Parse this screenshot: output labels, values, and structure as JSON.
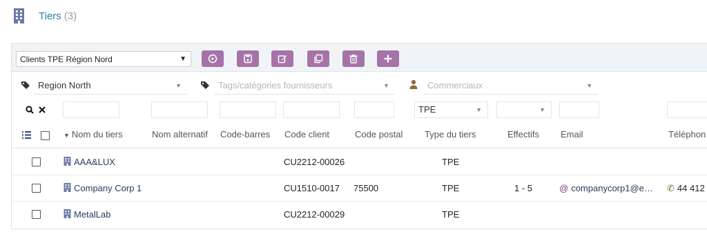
{
  "header": {
    "title": "Tiers",
    "count": "(3)"
  },
  "toolbar": {
    "view_select": "Clients TPE Région Nord",
    "buttons": [
      "play-icon",
      "save-icon",
      "edit-icon",
      "copy-icon",
      "trash-icon",
      "plus-icon"
    ]
  },
  "filters": {
    "region": "Region North",
    "tags_placeholder": "Tags/catégories fournisseurs",
    "sales_placeholder": "Commerciaux"
  },
  "search": {
    "type_value": "TPE"
  },
  "columns": [
    "Nom du tiers",
    "Nom alternatif",
    "Code-barres",
    "Code client",
    "Code postal",
    "Type du tiers",
    "Effectifs",
    "Email",
    "Téléphon"
  ],
  "rows": [
    {
      "name": "AAA&LUX",
      "code_client": "CU2212-00026",
      "code_postal": "",
      "type": "TPE",
      "effectifs": "",
      "email": "",
      "phone": ""
    },
    {
      "name": "Company Corp 1",
      "code_client": "CU1510-0017",
      "code_postal": "75500",
      "type": "TPE",
      "effectifs": "1 - 5",
      "email": "companycorp1@e…",
      "phone": "44 412"
    },
    {
      "name": "MetalLab",
      "code_client": "CU2212-00029",
      "code_postal": "",
      "type": "TPE",
      "effectifs": "",
      "email": "",
      "phone": ""
    }
  ],
  "colors": {
    "accent": "#a673a9",
    "title": "#2a7da8",
    "link": "#263c5c"
  }
}
